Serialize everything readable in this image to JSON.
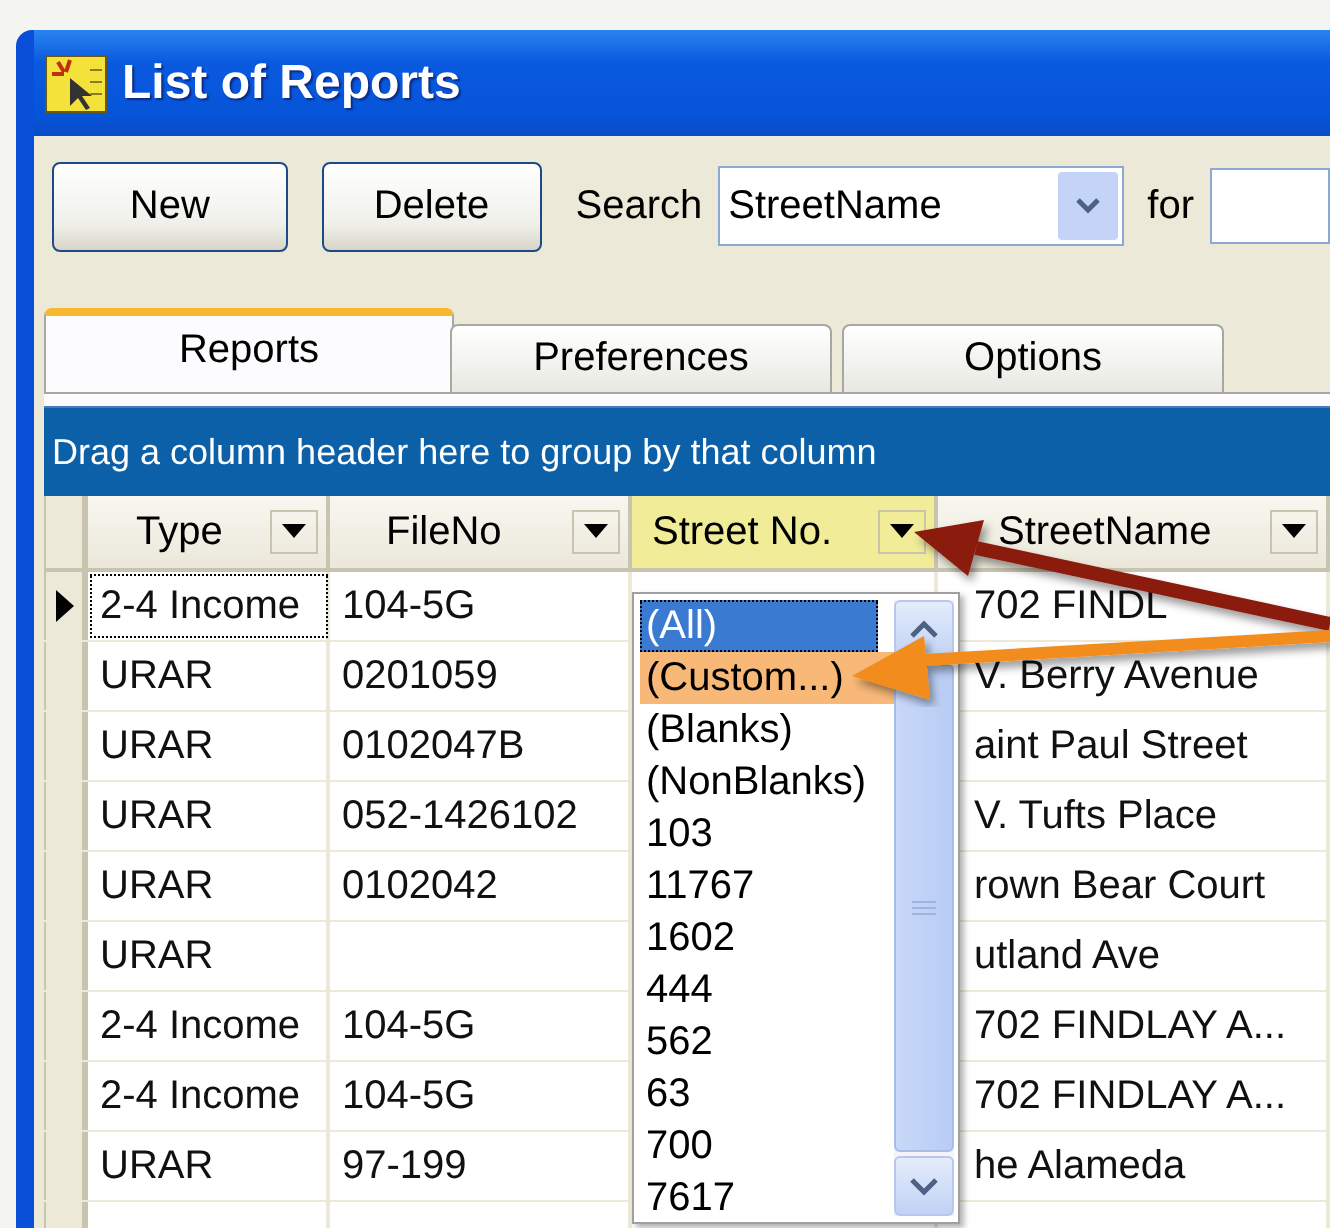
{
  "window": {
    "title": "List of Reports"
  },
  "toolbar": {
    "buttons": [
      "New",
      "Delete"
    ],
    "search_label": "Search",
    "search_field": {
      "value": "StreetName"
    },
    "for_label": "for"
  },
  "tabs": [
    {
      "label": "Reports",
      "selected": true
    },
    {
      "label": "Preferences",
      "selected": false
    },
    {
      "label": "Options",
      "selected": false
    }
  ],
  "grid": {
    "group_hint": "Drag a column header here to group by that column",
    "columns": [
      {
        "label": "Type",
        "highlighted": false
      },
      {
        "label": "FileNo",
        "highlighted": false
      },
      {
        "label": "Street No.",
        "highlighted": true
      },
      {
        "label": "StreetName",
        "highlighted": false
      }
    ],
    "rows": [
      {
        "current": true,
        "cells": [
          "2-4 Income",
          "104-5G",
          "",
          "702 FINDL"
        ]
      },
      {
        "current": false,
        "cells": [
          "URAR",
          "0201059",
          "",
          "V. Berry Avenue"
        ]
      },
      {
        "current": false,
        "cells": [
          "URAR",
          "0102047B",
          "",
          "aint Paul Street"
        ]
      },
      {
        "current": false,
        "cells": [
          "URAR",
          "052-1426102",
          "",
          "V. Tufts Place"
        ]
      },
      {
        "current": false,
        "cells": [
          "URAR",
          "0102042",
          "",
          "rown Bear Court"
        ]
      },
      {
        "current": false,
        "cells": [
          "URAR",
          "",
          "",
          "utland Ave"
        ]
      },
      {
        "current": false,
        "cells": [
          "2-4 Income",
          "104-5G",
          "",
          "702 FINDLAY A..."
        ]
      },
      {
        "current": false,
        "cells": [
          "2-4 Income",
          "104-5G",
          "",
          "702 FINDLAY A..."
        ]
      },
      {
        "current": false,
        "cells": [
          "URAR",
          "97-199",
          "",
          "he Alameda"
        ]
      }
    ]
  },
  "filter_dropdown": {
    "items": [
      {
        "label": "(All)",
        "selected": true,
        "hovered": false
      },
      {
        "label": "(Custom...)",
        "selected": false,
        "hovered": true
      },
      {
        "label": "(Blanks)",
        "selected": false,
        "hovered": false
      },
      {
        "label": "(NonBlanks)",
        "selected": false,
        "hovered": false
      },
      {
        "label": "103",
        "selected": false,
        "hovered": false
      },
      {
        "label": "11767",
        "selected": false,
        "hovered": false
      },
      {
        "label": "1602",
        "selected": false,
        "hovered": false
      },
      {
        "label": "444",
        "selected": false,
        "hovered": false
      },
      {
        "label": "562",
        "selected": false,
        "hovered": false
      },
      {
        "label": "63",
        "selected": false,
        "hovered": false
      },
      {
        "label": "700",
        "selected": false,
        "hovered": false
      },
      {
        "label": "7617",
        "selected": false,
        "hovered": false
      }
    ]
  }
}
